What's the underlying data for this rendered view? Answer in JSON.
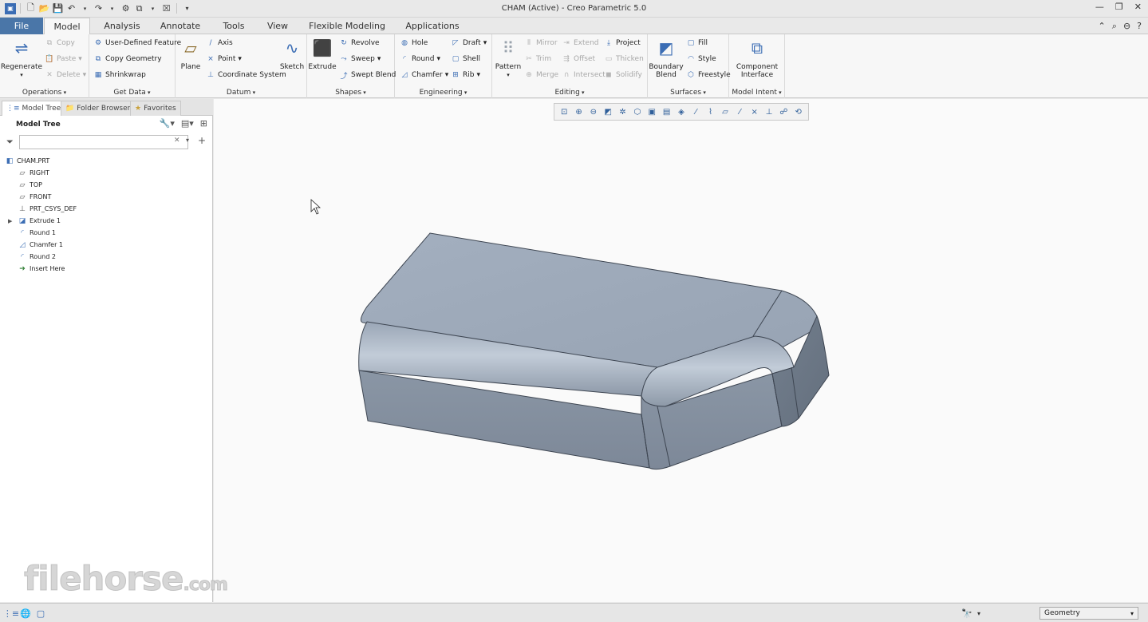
{
  "window": {
    "title": "CHAM (Active) - Creo Parametric 5.0"
  },
  "tabs": [
    "File",
    "Model",
    "Analysis",
    "Annotate",
    "Tools",
    "View",
    "Flexible Modeling",
    "Applications"
  ],
  "ribbon": {
    "operations": {
      "label": "Operations",
      "regenerate": "Regenerate",
      "copy": "Copy",
      "paste": "Paste",
      "delete": "Delete"
    },
    "get_data": {
      "label": "Get Data",
      "udf": "User-Defined Feature",
      "copy_geometry": "Copy Geometry",
      "shrinkwrap": "Shrinkwrap"
    },
    "datum": {
      "label": "Datum",
      "plane": "Plane",
      "axis": "Axis",
      "point": "Point",
      "csys": "Coordinate System",
      "sketch": "Sketch"
    },
    "shapes": {
      "label": "Shapes",
      "extrude": "Extrude",
      "revolve": "Revolve",
      "sweep": "Sweep",
      "swept_blend": "Swept Blend"
    },
    "engineering": {
      "label": "Engineering",
      "hole": "Hole",
      "round": "Round",
      "chamfer": "Chamfer",
      "draft": "Draft",
      "shell": "Shell",
      "rib": "Rib"
    },
    "editing": {
      "label": "Editing",
      "pattern": "Pattern",
      "mirror": "Mirror",
      "trim": "Trim",
      "merge": "Merge",
      "extend": "Extend",
      "offset": "Offset",
      "intersect": "Intersect",
      "project": "Project",
      "thicken": "Thicken",
      "solidify": "Solidify"
    },
    "surfaces": {
      "label": "Surfaces",
      "boundary_blend_1": "Boundary",
      "boundary_blend_2": "Blend",
      "fill": "Fill",
      "style": "Style",
      "freestyle": "Freestyle"
    },
    "model_intent": {
      "label": "Model Intent",
      "component_1": "Component",
      "component_2": "Interface"
    }
  },
  "panel": {
    "tabs": [
      "Model Tree",
      "Folder Browser",
      "Favorites"
    ],
    "header": "Model Tree",
    "filter_placeholder": "",
    "tree": [
      {
        "label": "CHAM.PRT",
        "icon": "part-icon"
      },
      {
        "label": "RIGHT",
        "icon": "datum-plane-icon"
      },
      {
        "label": "TOP",
        "icon": "datum-plane-icon"
      },
      {
        "label": "FRONT",
        "icon": "datum-plane-icon"
      },
      {
        "label": "PRT_CSYS_DEF",
        "icon": "csys-icon"
      },
      {
        "label": "Extrude 1",
        "icon": "extrude-icon"
      },
      {
        "label": "Round 1",
        "icon": "round-icon"
      },
      {
        "label": "Chamfer 1",
        "icon": "chamfer-icon"
      },
      {
        "label": "Round 2",
        "icon": "round-icon"
      },
      {
        "label": "Insert Here",
        "icon": "insert-arrow-icon"
      }
    ]
  },
  "status": {
    "selection_filter": "Geometry"
  },
  "watermark": {
    "brand": "filehorse",
    "suffix": ".com"
  },
  "colors": {
    "file_tab": "#4a76a8",
    "model_face_top": "#9eabbb",
    "model_face_front": "#7f8b9a",
    "accent": "#3b6db4"
  }
}
